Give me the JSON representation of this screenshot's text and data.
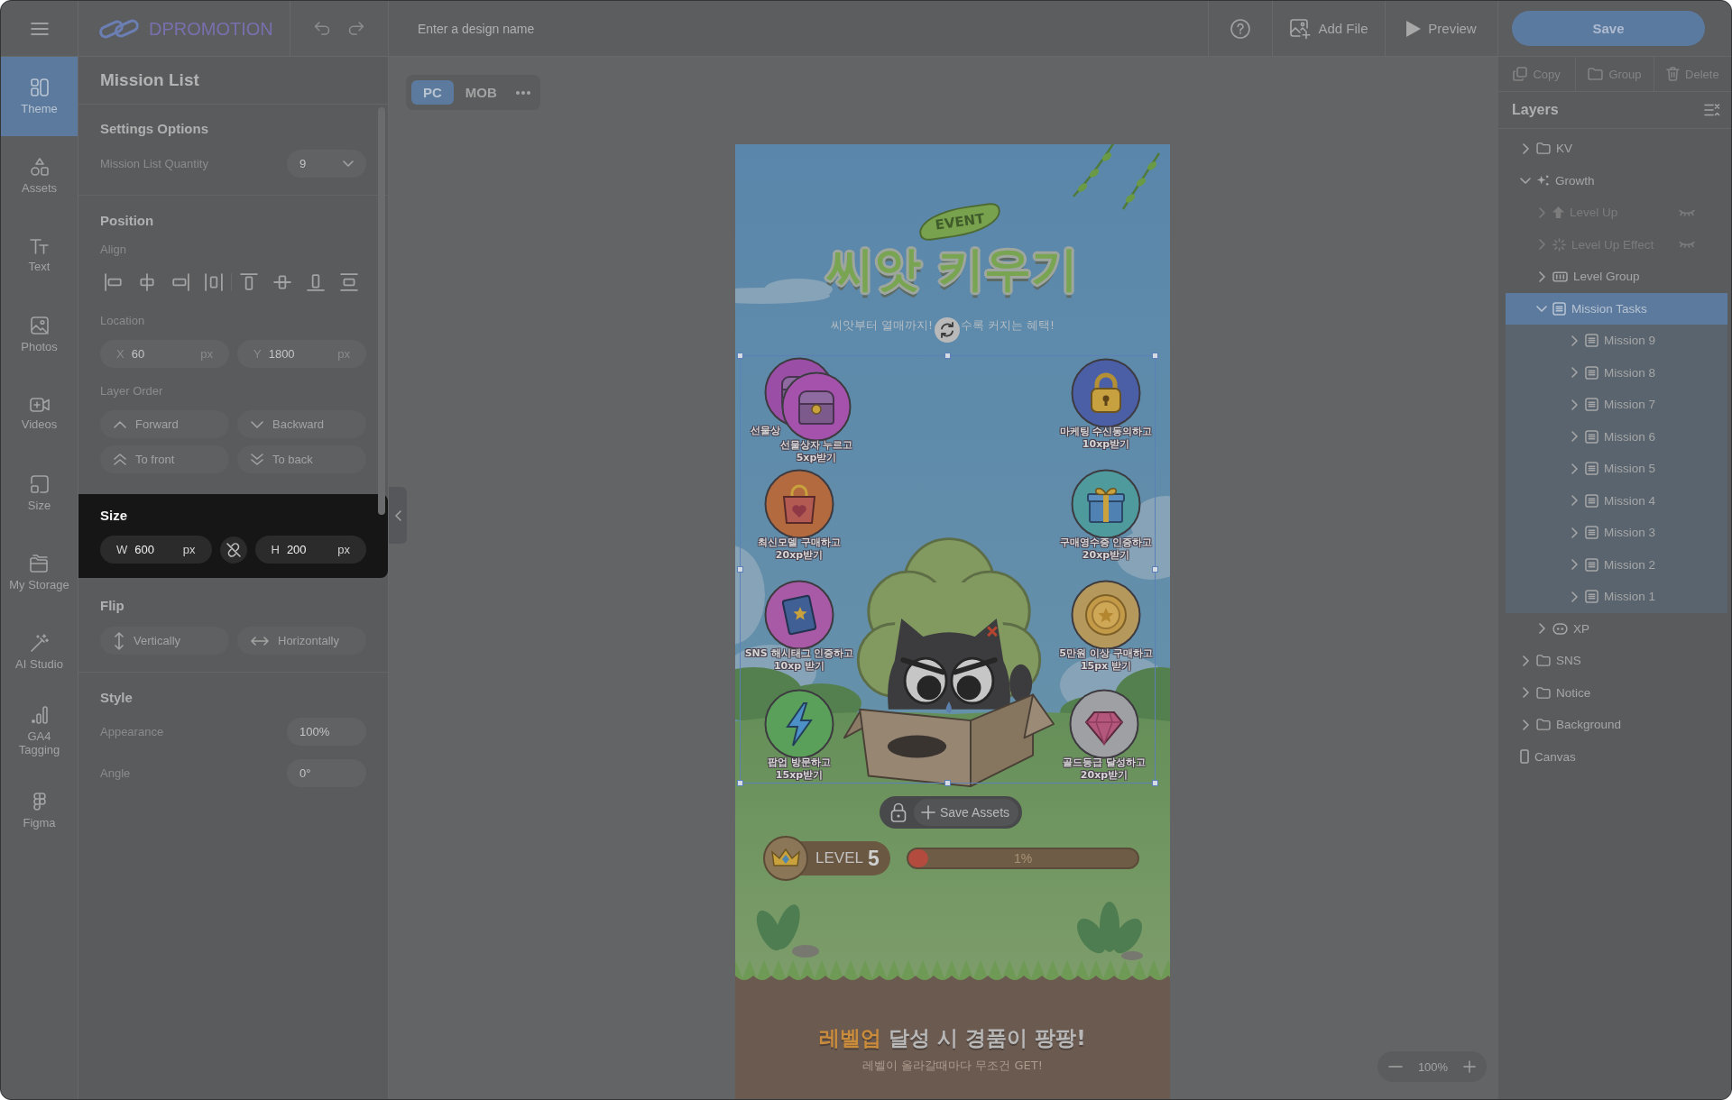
{
  "topbar": {
    "logo": "DPROMOTION",
    "design_name": {
      "placeholder": "Enter a design name"
    },
    "actions": [
      {
        "kind": "help"
      },
      {
        "kind": "add-file",
        "label": "Add File"
      },
      {
        "kind": "preview",
        "label": "Preview"
      }
    ],
    "save": "Save"
  },
  "rail": [
    {
      "label": "Theme",
      "selected": true
    },
    {
      "label": "Assets",
      "selected": false
    },
    {
      "label": "Text",
      "selected": false
    },
    {
      "label": "Photos",
      "selected": false
    },
    {
      "label": "Videos",
      "selected": false
    },
    {
      "label": "Size",
      "selected": false
    },
    {
      "label": "My Storage",
      "selected": false
    },
    {
      "label": "AI Studio",
      "selected": false
    },
    {
      "label": "GA4 Tagging",
      "selected": false
    },
    {
      "label": "Figma",
      "selected": false
    }
  ],
  "panel": {
    "title": "Mission List",
    "settings": {
      "heading": "Settings Options",
      "rows": [
        {
          "kind": "dropdown",
          "label": "Mission List Quantity",
          "value": "9"
        }
      ]
    },
    "position": {
      "heading": "Position",
      "align_label": "Align",
      "location_label": "Location",
      "location": [
        {
          "axis": "X",
          "value": "60",
          "unit": "px"
        },
        {
          "axis": "Y",
          "value": "1800",
          "unit": "px"
        }
      ],
      "order_label": "Layer Order",
      "order_buttons": [
        "Forward",
        "Backward",
        "To front",
        "To back"
      ]
    },
    "size": {
      "heading": "Size",
      "highlighted": true,
      "fields": [
        {
          "axis": "W",
          "value": "600",
          "unit": "px"
        },
        {
          "axis": "H",
          "value": "200",
          "unit": "px"
        }
      ],
      "ratio_locked": false
    },
    "flip": {
      "heading": "Flip",
      "buttons": [
        "Vertically",
        "Horizontally"
      ]
    },
    "style": {
      "heading": "Style",
      "rows": [
        {
          "kind": "input",
          "label": "Appearance",
          "value": "100%"
        },
        {
          "kind": "input",
          "label": "Angle",
          "value": "0°"
        }
      ]
    }
  },
  "canvas": {
    "devices": [
      {
        "label": "PC",
        "selected": true
      },
      {
        "label": "MOB",
        "selected": false
      }
    ],
    "artboard": {
      "badge": "EVENT",
      "title": "씨앗 키우기",
      "subtitle": [
        "씨앗부터 열매까지!",
        "수록 커지는 혜택!"
      ],
      "missions": [
        {
          "lines": [
            "선물상"
          ],
          "color": "#9a4ea6"
        },
        {
          "lines": [
            "선물상자 누르고",
            "5xp받기"
          ],
          "color": "#a452ab"
        },
        {
          "lines": [
            "마케팅 수신동의하고",
            "10xp받기"
          ],
          "color": "#4b5fa6"
        },
        {
          "lines": [
            "최신모델 구매하고",
            "20xp받기"
          ],
          "color": "#b36a3f"
        },
        {
          "lines": [
            "구매영수증 인증하고",
            "20xp받기"
          ],
          "color": "#4f9a9c"
        },
        {
          "lines": [
            "SNS 해시태그 인증하고",
            "10xp 받기"
          ],
          "color": "#a85aa6"
        },
        {
          "lines": [
            "5만원 이상 구매하고",
            "15px 받기"
          ],
          "color": "#b5995c"
        },
        {
          "lines": [
            "팝업 방문하고",
            "15xp받기"
          ],
          "color": "#5aa05a"
        },
        {
          "lines": [
            "골드등급 달성하고",
            "20xp받기"
          ],
          "color": "#9fa0a3"
        }
      ],
      "level": {
        "label": "LEVEL",
        "number": "5",
        "progress": {
          "level": 0.01,
          "reading": "1%"
        }
      },
      "headline": {
        "highlight": "레벨업",
        "rest": "달성 시 경품이 팡팡!"
      },
      "note": "레벨이 올라갈때마다 무조건 GET!"
    },
    "asset_toolbar": {
      "save_label": "Save Assets"
    },
    "zoom": "100%"
  },
  "layers": {
    "actions": [
      "Copy",
      "Group",
      "Delete"
    ],
    "title": "Layers",
    "tree": [
      {
        "label": "KV",
        "kind": "folder",
        "expanded": false,
        "selected": false,
        "hidden": false
      },
      {
        "label": "Growth",
        "kind": "effects",
        "expanded": true,
        "selected": false,
        "hidden": false,
        "children": [
          {
            "label": "Level Up",
            "kind": "shape",
            "expanded": false,
            "selected": false,
            "hidden": true
          },
          {
            "label": "Level Up Effect",
            "kind": "animation",
            "expanded": false,
            "selected": false,
            "hidden": true
          },
          {
            "label": "Level Group",
            "kind": "level",
            "expanded": false,
            "selected": false,
            "hidden": false
          },
          {
            "label": "Mission Tasks",
            "kind": "list",
            "expanded": true,
            "selected": true,
            "hidden": false,
            "children": [
              {
                "label": "Mission 9",
                "kind": "list",
                "expanded": false,
                "selected": false,
                "hidden": false
              },
              {
                "label": "Mission 8",
                "kind": "list",
                "expanded": false,
                "selected": false,
                "hidden": false
              },
              {
                "label": "Mission 7",
                "kind": "list",
                "expanded": false,
                "selected": false,
                "hidden": false
              },
              {
                "label": "Mission 6",
                "kind": "list",
                "expanded": false,
                "selected": false,
                "hidden": false
              },
              {
                "label": "Mission 5",
                "kind": "list",
                "expanded": false,
                "selected": false,
                "hidden": false
              },
              {
                "label": "Mission 4",
                "kind": "list",
                "expanded": false,
                "selected": false,
                "hidden": false
              },
              {
                "label": "Mission 3",
                "kind": "list",
                "expanded": false,
                "selected": false,
                "hidden": false
              },
              {
                "label": "Mission 2",
                "kind": "list",
                "expanded": false,
                "selected": false,
                "hidden": false
              },
              {
                "label": "Mission 1",
                "kind": "list",
                "expanded": false,
                "selected": false,
                "hidden": false
              }
            ]
          },
          {
            "label": "XP",
            "kind": "xp",
            "expanded": false,
            "selected": false,
            "hidden": false
          }
        ]
      },
      {
        "label": "SNS",
        "kind": "folder",
        "expanded": false,
        "selected": false,
        "hidden": false
      },
      {
        "label": "Notice",
        "kind": "folder",
        "expanded": false,
        "selected": false,
        "hidden": false
      },
      {
        "label": "Background",
        "kind": "folder",
        "expanded": false,
        "selected": false,
        "hidden": false
      },
      {
        "label": "Canvas",
        "kind": "canvas",
        "selected": false,
        "hidden": false
      }
    ]
  }
}
